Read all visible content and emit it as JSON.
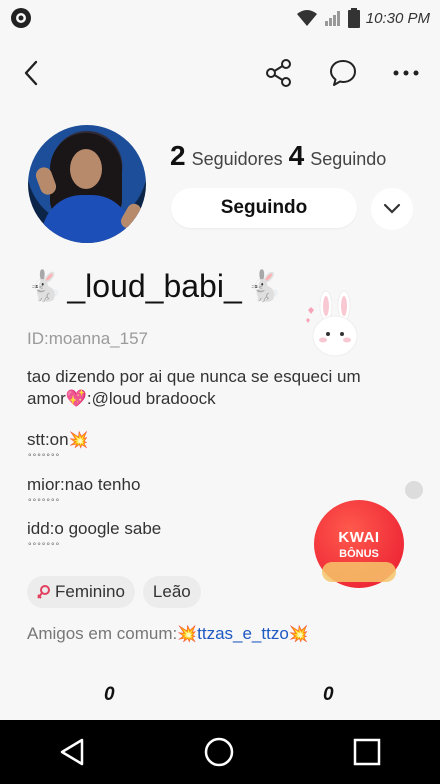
{
  "status_bar": {
    "time": "10:30 PM"
  },
  "profile": {
    "followers_count": "2",
    "followers_label": "Seguidores",
    "following_count": "4",
    "following_label": "Seguindo",
    "follow_button_label": "Seguindo",
    "username": "_loud_babi_",
    "user_id": "ID:moanna_157",
    "bio_line1": "tao dizendo por ai que nunca se esqueci um",
    "bio_line2_prefix": "amor",
    "bio_line2_suffix": ":@loud bradoock",
    "stt": "stt:on",
    "mior": "mior:nao tenho",
    "idd": "idd:o google sabe",
    "dots": "°°°°°°°",
    "tags": [
      "Feminino",
      "Leão"
    ],
    "mutual_label": "Amigos em comum:",
    "mutual_name": "ttzas_e_ttzo",
    "counts": [
      "0",
      "0"
    ]
  },
  "kwai_badge": {
    "line1": "KWAI",
    "line2": "BÔNUS"
  },
  "icons": [
    "back-icon",
    "share-icon",
    "chat-icon",
    "more-icon",
    "chevron-down-icon",
    "nav-back-icon",
    "nav-home-icon",
    "nav-recents-icon"
  ]
}
